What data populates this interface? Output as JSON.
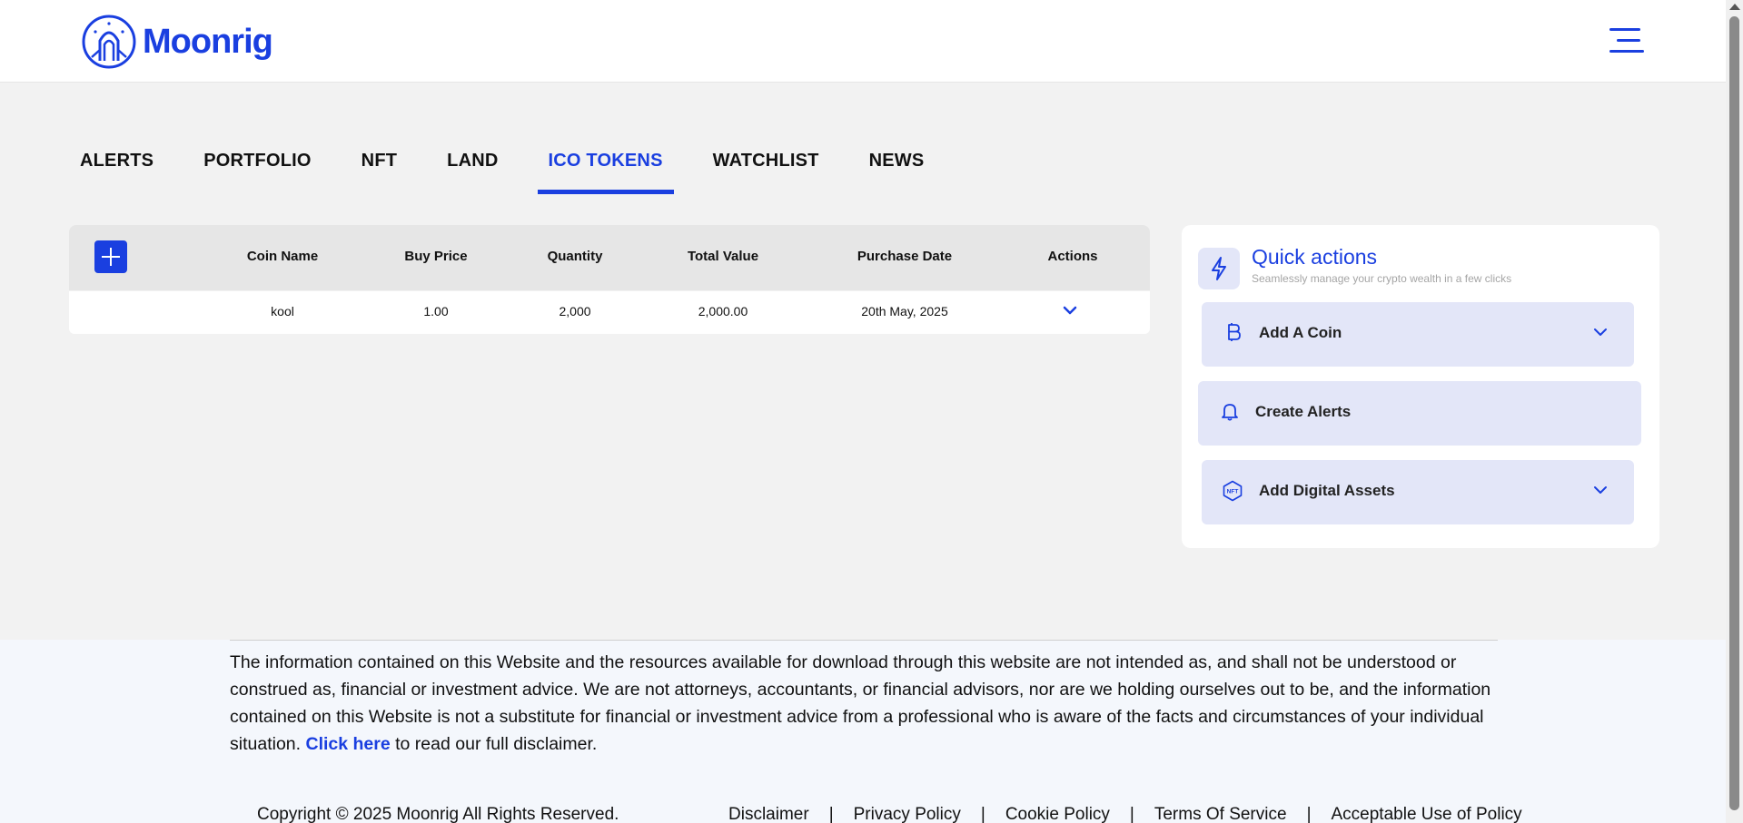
{
  "brand": {
    "name": "Moonrig",
    "color": "#1a3fe0"
  },
  "nav": {
    "tabs": [
      {
        "label": "ALERTS",
        "active": false
      },
      {
        "label": "PORTFOLIO",
        "active": false
      },
      {
        "label": "NFT",
        "active": false
      },
      {
        "label": "LAND",
        "active": false
      },
      {
        "label": "ICO TOKENS",
        "active": true
      },
      {
        "label": "WATCHLIST",
        "active": false
      },
      {
        "label": "NEWS",
        "active": false
      }
    ]
  },
  "table": {
    "columns": [
      "Coin Name",
      "Buy Price",
      "Quantity",
      "Total Value",
      "Purchase Date",
      "Actions"
    ],
    "rows": [
      {
        "coin_name": "kool",
        "buy_price": "1.00",
        "quantity": "2,000",
        "total_value": "2,000.00",
        "purchase_date": "20th May, 2025",
        "action_icon": "chevron-down-icon"
      }
    ]
  },
  "quick_actions": {
    "title": "Quick actions",
    "subtitle": "Seamlessly manage your crypto wealth in a few clicks",
    "items": [
      {
        "label": "Add A Coin",
        "icon": "bitcoin-icon",
        "expandable": true
      },
      {
        "label": "Create Alerts",
        "icon": "bell-icon",
        "expandable": false
      },
      {
        "label": "Add Digital Assets",
        "icon": "nft-icon",
        "expandable": true
      }
    ]
  },
  "footer": {
    "disclaimer_text": "The information contained on this Website and the resources available for download through this website are not intended as, and shall not be understood or construed as, financial or investment advice. We are not attorneys, accountants, or financial advisors, nor are we holding ourselves out to be, and the information contained on this Website is not a substitute for financial or investment advice from a professional who is aware of the facts and circumstances of your individual situation.",
    "disclaimer_link": "Click here",
    "disclaimer_tail": "to read our full disclaimer.",
    "copyright": "Copyright © 2025 Moonrig All Rights Reserved.",
    "links": [
      "Disclaimer",
      "Privacy Policy",
      "Cookie Policy",
      "Terms Of Service",
      "Acceptable Use of Policy"
    ]
  }
}
